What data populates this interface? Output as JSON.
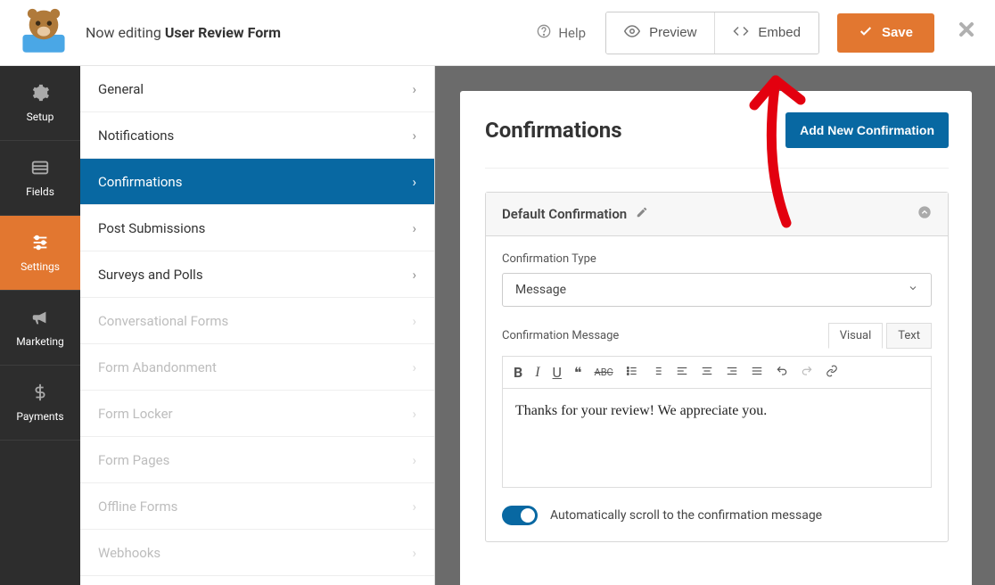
{
  "header": {
    "editing_prefix": "Now editing ",
    "form_name": "User Review Form",
    "help_label": "Help",
    "preview_label": "Preview",
    "embed_label": "Embed",
    "save_label": "Save"
  },
  "nav": {
    "setup": "Setup",
    "fields": "Fields",
    "settings": "Settings",
    "marketing": "Marketing",
    "payments": "Payments"
  },
  "panel": {
    "items": [
      {
        "label": "General",
        "disabled": false
      },
      {
        "label": "Notifications",
        "disabled": false
      },
      {
        "label": "Confirmations",
        "disabled": false,
        "selected": true
      },
      {
        "label": "Post Submissions",
        "disabled": false
      },
      {
        "label": "Surveys and Polls",
        "disabled": false
      },
      {
        "label": "Conversational Forms",
        "disabled": true
      },
      {
        "label": "Form Abandonment",
        "disabled": true
      },
      {
        "label": "Form Locker",
        "disabled": true
      },
      {
        "label": "Form Pages",
        "disabled": true
      },
      {
        "label": "Offline Forms",
        "disabled": true
      },
      {
        "label": "Webhooks",
        "disabled": true
      }
    ]
  },
  "main": {
    "title": "Confirmations",
    "add_button": "Add New Confirmation",
    "box_title": "Default Confirmation",
    "type_label": "Confirmation Type",
    "type_value": "Message",
    "message_label": "Confirmation Message",
    "tab_visual": "Visual",
    "tab_text": "Text",
    "message_value": "Thanks for your review! We appreciate you.",
    "switch_label": "Automatically scroll to the confirmation message"
  }
}
